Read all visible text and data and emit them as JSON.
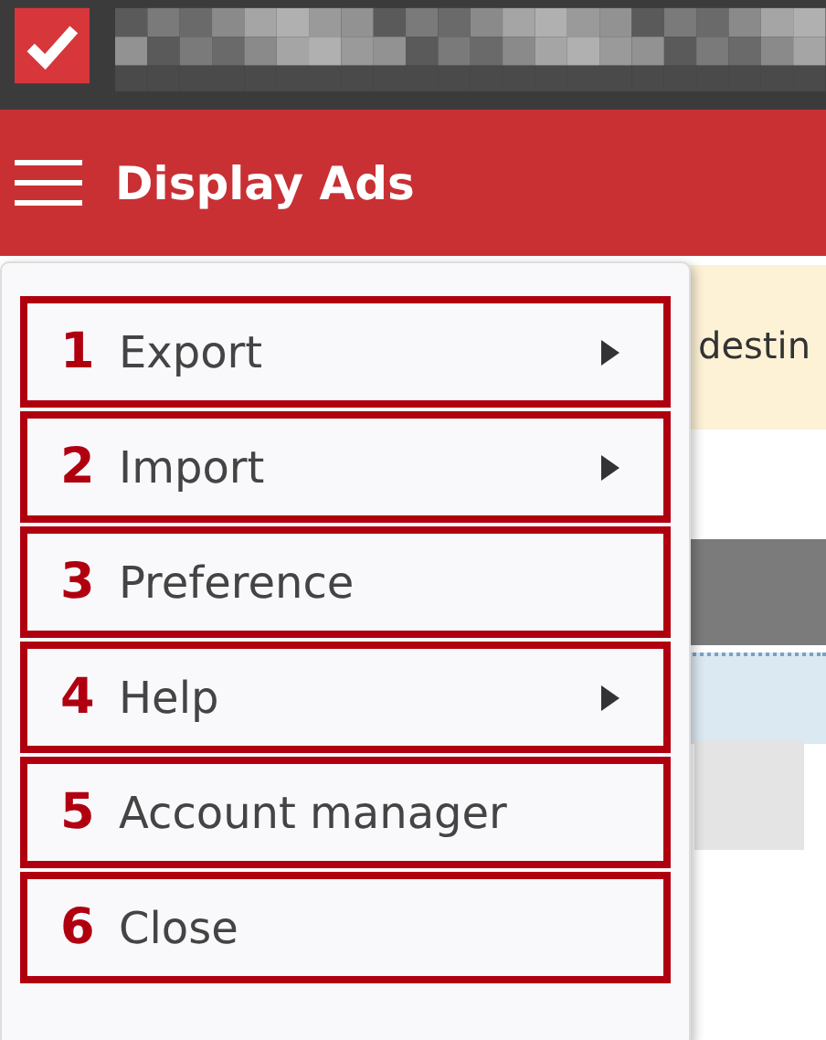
{
  "app_bar": {
    "title": "Display Ads"
  },
  "background": {
    "banner_text": "destin"
  },
  "menu": {
    "items": [
      {
        "number": "1",
        "label": "Export",
        "has_submenu": true
      },
      {
        "number": "2",
        "label": "Import",
        "has_submenu": true
      },
      {
        "number": "3",
        "label": "Preference",
        "has_submenu": false
      },
      {
        "number": "4",
        "label": "Help",
        "has_submenu": true
      },
      {
        "number": "5",
        "label": "Account manager",
        "has_submenu": false
      },
      {
        "number": "6",
        "label": "Close",
        "has_submenu": false
      }
    ]
  }
}
